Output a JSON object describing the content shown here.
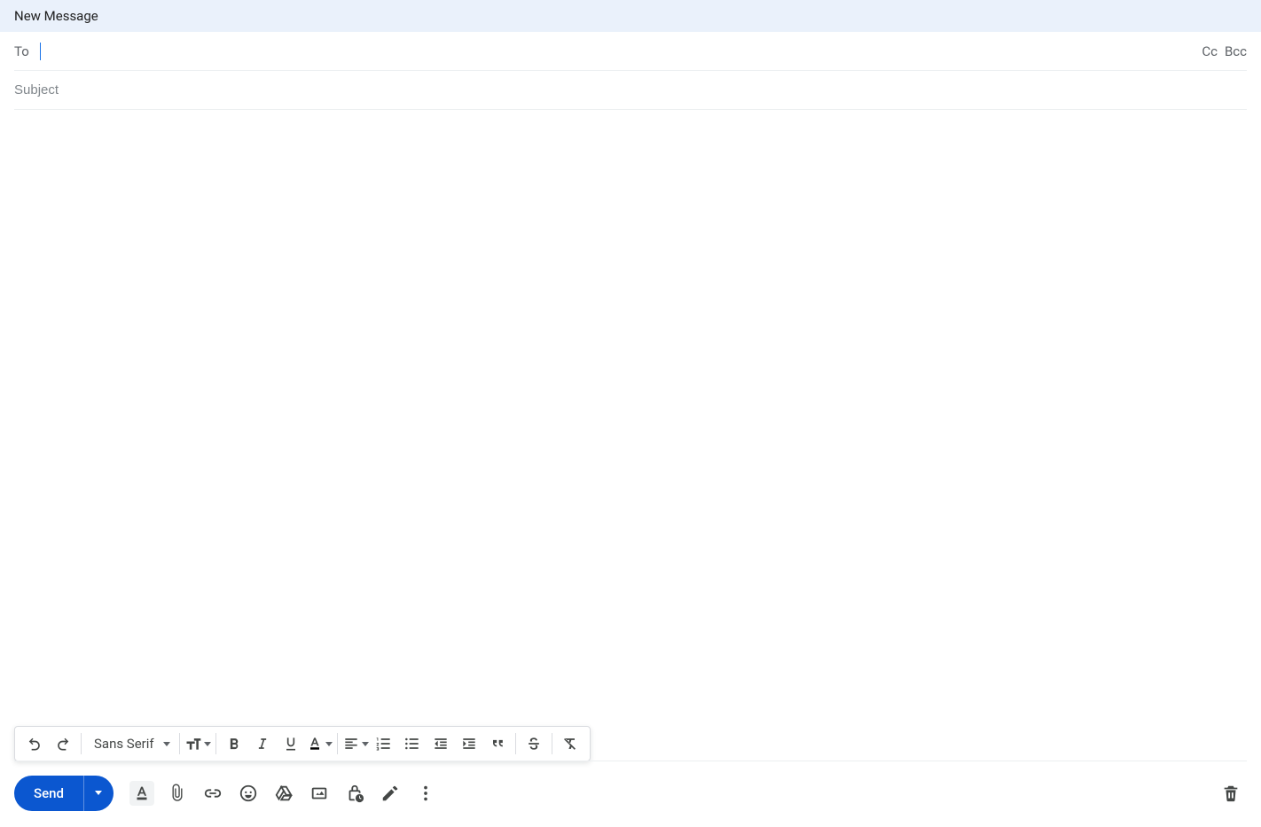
{
  "header": {
    "title": "New Message"
  },
  "recipients": {
    "to_label": "To",
    "cc_label": "Cc",
    "bcc_label": "Bcc",
    "to_value": ""
  },
  "subject": {
    "placeholder": "Subject",
    "value": ""
  },
  "body": {
    "value": ""
  },
  "formatting": {
    "font_family_label": "Sans Serif"
  },
  "actions": {
    "send_label": "Send"
  },
  "colors": {
    "accent": "#0b57d0",
    "titlebar_bg": "#eaf1fb"
  }
}
